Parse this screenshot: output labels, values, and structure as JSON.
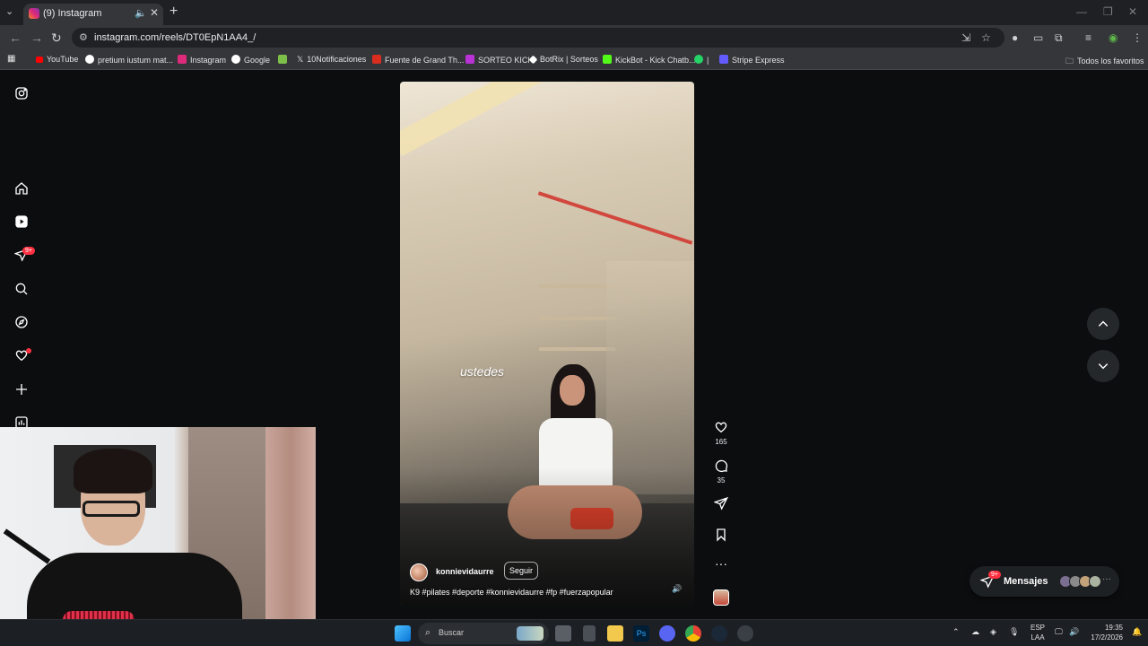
{
  "browser": {
    "tab": {
      "title": "(9) Instagram"
    },
    "url": "instagram.com/reels/DT0EpN1AA4_/",
    "bookmarks": [
      {
        "label": "YouTube",
        "color": "#ff0000"
      },
      {
        "label": "pretium iustum mat...",
        "color": "#ffffff"
      },
      {
        "label": "Instagram",
        "color": "#dd2a7b"
      },
      {
        "label": "Google",
        "color": "#ffffff"
      },
      {
        "label": "",
        "color": "#7cc04a"
      },
      {
        "label": "10Notificaciones",
        "color": "#ffffff"
      },
      {
        "label": "Fuente de Grand Th...",
        "color": "#d92d20"
      },
      {
        "label": "SORTEO KICK",
        "color": "#b832d6"
      },
      {
        "label": "BotRix | Sorteos",
        "color": "#ffffff"
      },
      {
        "label": "KickBot - Kick Chatb...",
        "color": "#53fc18"
      },
      {
        "label": "|",
        "color": "#25d366"
      },
      {
        "label": "Stripe Express",
        "color": "#635bff"
      }
    ],
    "all_bookmarks": "Todos los favoritos"
  },
  "sidebar": {
    "notifications_badge": "9+"
  },
  "reel": {
    "overlay_word": "ustedes",
    "username": "konnievidaurre",
    "follow_label": "Seguir",
    "caption": "K9 #pilates #deporte #konnievidaurre #fp #fuerzapopular",
    "likes": "165",
    "comments": "35"
  },
  "messages": {
    "label": "Mensajes",
    "badge": "9+"
  },
  "taskbar": {
    "search_label": "Buscar",
    "lang_top": "ESP",
    "lang_bottom": "LAA",
    "time": "19:35",
    "date": "17/2/2026"
  },
  "colors": {
    "ig_badge": "#ff3040",
    "page_bg": "#0b0d0f"
  }
}
